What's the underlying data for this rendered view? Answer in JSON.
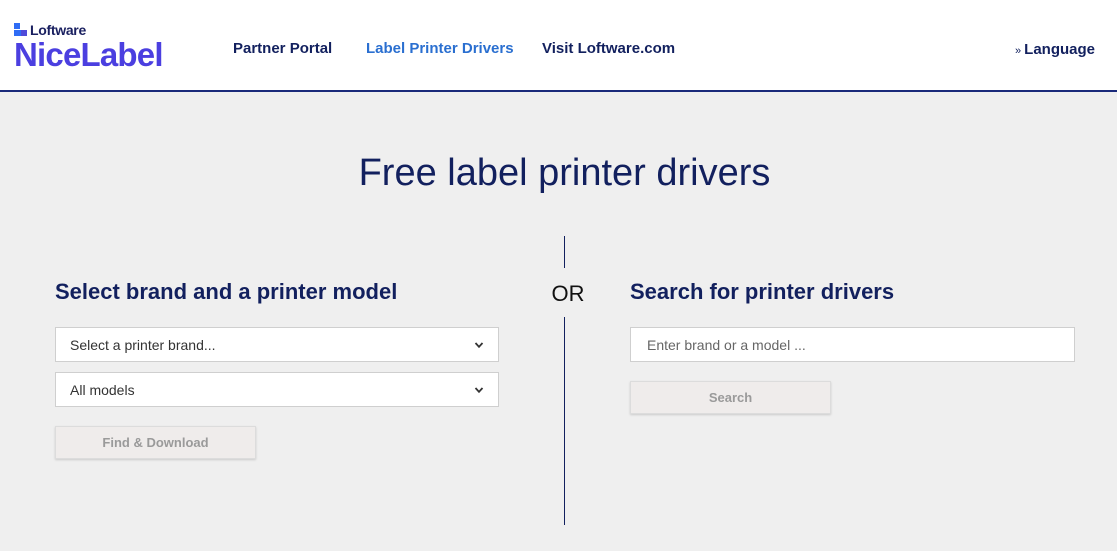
{
  "logo": {
    "small": "Loftware",
    "big": "NiceLabel"
  },
  "nav": {
    "partner_portal": "Partner Portal",
    "label_printer_drivers": "Label Printer Drivers",
    "visit_loftware": "Visit Loftware.com",
    "language_prefix": "»",
    "language": "Language",
    "active_color": "#2a6fd0"
  },
  "hero": {
    "title": "Free label printer drivers"
  },
  "left": {
    "heading": "Select brand and a printer model",
    "brand_select_value": "Select a printer brand...",
    "model_select_value": "All models",
    "find_button": "Find & Download"
  },
  "separator": {
    "or": "OR"
  },
  "right": {
    "heading": "Search for printer drivers",
    "search_placeholder": "Enter brand or a model ...",
    "search_button": "Search"
  },
  "colors": {
    "brand_navy": "#12205e",
    "brand_purple": "#4b3fe0",
    "background": "#efefef"
  }
}
